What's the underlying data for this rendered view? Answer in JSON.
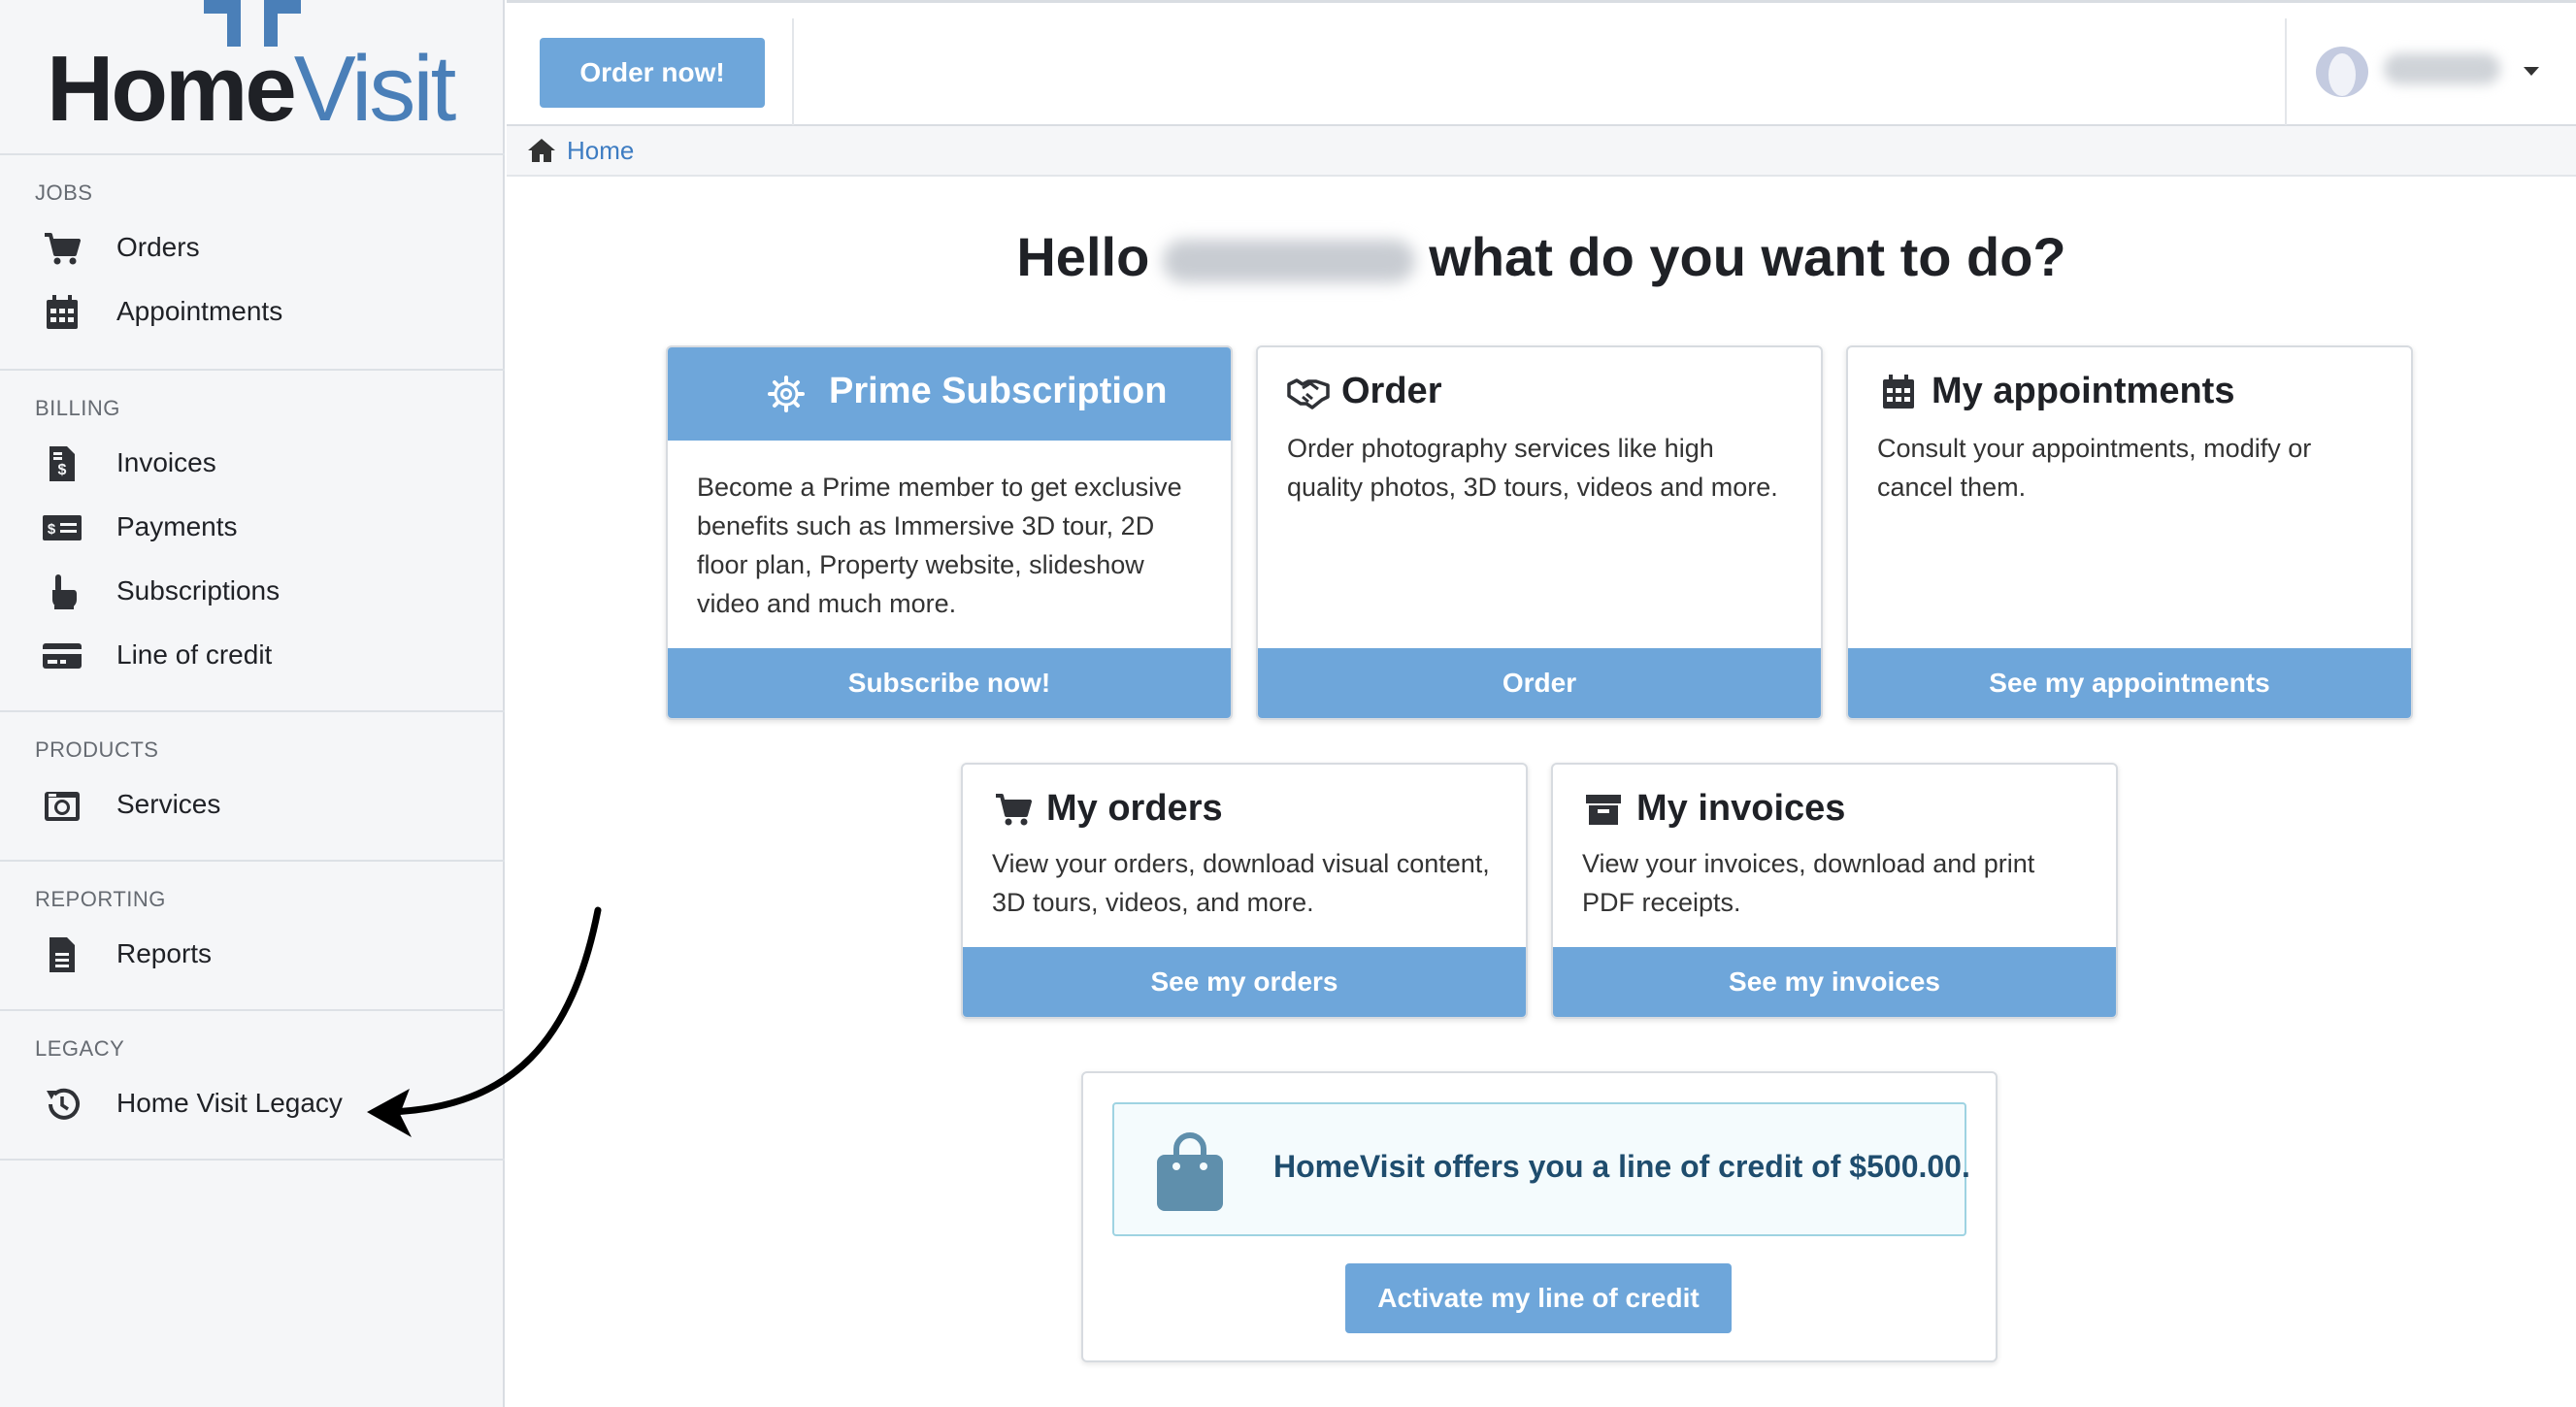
{
  "brand": {
    "name_part1": "Home",
    "name_part2": "Visit"
  },
  "sidebar": {
    "sections": [
      {
        "title": "JOBS",
        "items": [
          {
            "label": "Orders",
            "icon": "cart-icon"
          },
          {
            "label": "Appointments",
            "icon": "calendar-icon"
          }
        ]
      },
      {
        "title": "BILLING",
        "items": [
          {
            "label": "Invoices",
            "icon": "invoice-icon"
          },
          {
            "label": "Payments",
            "icon": "money-icon"
          },
          {
            "label": "Subscriptions",
            "icon": "pointer-hand-icon"
          },
          {
            "label": "Line of credit",
            "icon": "credit-card-icon"
          }
        ]
      },
      {
        "title": "PRODUCTS",
        "items": [
          {
            "label": "Services",
            "icon": "camera-icon"
          }
        ]
      },
      {
        "title": "REPORTING",
        "items": [
          {
            "label": "Reports",
            "icon": "file-icon"
          }
        ]
      },
      {
        "title": "LEGACY",
        "items": [
          {
            "label": "Home Visit Legacy",
            "icon": "history-icon"
          }
        ]
      }
    ]
  },
  "topbar": {
    "order_now_label": "Order now!"
  },
  "breadcrumb": {
    "home_label": "Home"
  },
  "greeting": {
    "prefix": "Hello",
    "suffix": "what do you want to do?"
  },
  "cards": {
    "prime": {
      "title": "Prime Subscription",
      "body": "Become a Prime member to get exclusive benefits such as Immersive 3D tour, 2D floor plan, Property website, slideshow video and much more.",
      "button": "Subscribe now!"
    },
    "order": {
      "title": "Order",
      "body": "Order photography services like high quality photos, 3D tours, videos and more.",
      "button": "Order"
    },
    "appointments": {
      "title": "My appointments",
      "body": "Consult your appointments, modify or cancel them.",
      "button": "See my appointments"
    },
    "orders": {
      "title": "My orders",
      "body": "View your orders, download visual content, 3D tours, videos, and more.",
      "button": "See my orders"
    },
    "invoices": {
      "title": "My invoices",
      "body": "View your invoices, download and print PDF receipts.",
      "button": "See my invoices"
    }
  },
  "credit": {
    "message": "HomeVisit offers you a line of credit of $500.00.",
    "button": "Activate my line of credit"
  },
  "colors": {
    "accent": "#6ea6da",
    "brand_blue": "#4a7fb8",
    "link": "#3d7cc2",
    "text_dark": "#1f2126"
  }
}
